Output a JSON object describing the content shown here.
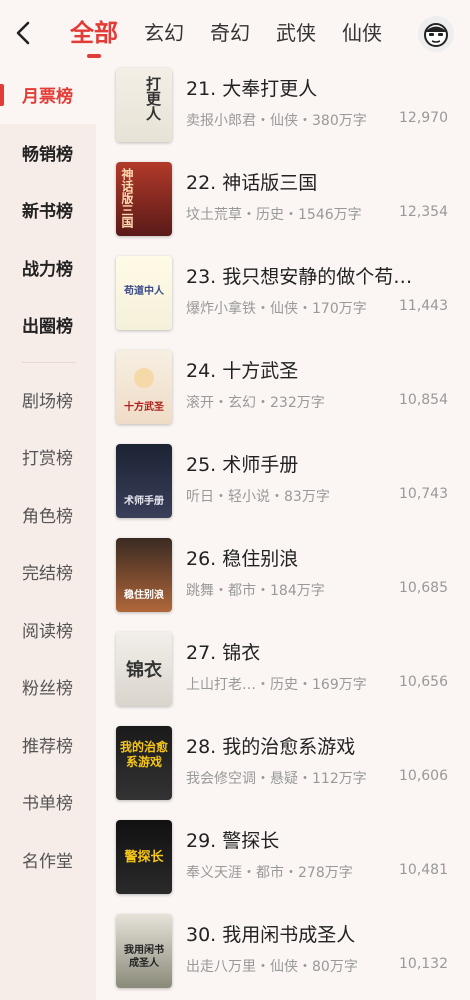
{
  "header": {
    "tabs": [
      "全部",
      "玄幻",
      "奇幻",
      "武侠",
      "仙侠"
    ],
    "active_tab": "全部"
  },
  "sidebar": {
    "primary": [
      "月票榜",
      "畅销榜",
      "新书榜",
      "战力榜",
      "出圈榜"
    ],
    "secondary": [
      "剧场榜",
      "打赏榜",
      "角色榜",
      "完结榜",
      "阅读榜",
      "粉丝榜",
      "推荐榜",
      "书单榜",
      "名作堂"
    ],
    "active": "月票榜"
  },
  "books": [
    {
      "rank": "21.",
      "name": "大奉打更人",
      "meta": "卖报小郎君・仙侠・380万字",
      "score": "12,970",
      "cover_text": "打更人"
    },
    {
      "rank": "22.",
      "name": "神话版三国",
      "meta": "坟土荒草・历史・1546万字",
      "score": "12,354",
      "cover_text": "神话版三国"
    },
    {
      "rank": "23.",
      "name": "我只想安静的做个苟…",
      "meta": "爆炸小拿铁・仙侠・170万字",
      "score": "11,443",
      "cover_text": "苟道中人"
    },
    {
      "rank": "24.",
      "name": "十方武圣",
      "meta": "滚开・玄幻・232万字",
      "score": "10,854",
      "cover_text": "十方武圣"
    },
    {
      "rank": "25.",
      "name": "术师手册",
      "meta": "听日・轻小说・83万字",
      "score": "10,743",
      "cover_text": "术师手册"
    },
    {
      "rank": "26.",
      "name": "稳住别浪",
      "meta": "跳舞・都市・184万字",
      "score": "10,685",
      "cover_text": "稳住别浪"
    },
    {
      "rank": "27.",
      "name": "锦衣",
      "meta": "上山打老…・历史・169万字",
      "score": "10,656",
      "cover_text": "锦衣"
    },
    {
      "rank": "28.",
      "name": "我的治愈系游戏",
      "meta": "我会修空调・悬疑・112万字",
      "score": "10,606",
      "cover_text": "我的治愈系游戏"
    },
    {
      "rank": "29.",
      "name": "警探长",
      "meta": "奉义天涯・都市・278万字",
      "score": "10,481",
      "cover_text": "警探长"
    },
    {
      "rank": "30.",
      "name": "我用闲书成圣人",
      "meta": "出走八万里・仙侠・80万字",
      "score": "10,132",
      "cover_text": "我用闲书成圣人"
    }
  ],
  "colors": {
    "accent": "#e33b36",
    "sidebar_bg": "#f6ece8",
    "page_bg": "#fbf6f3"
  }
}
